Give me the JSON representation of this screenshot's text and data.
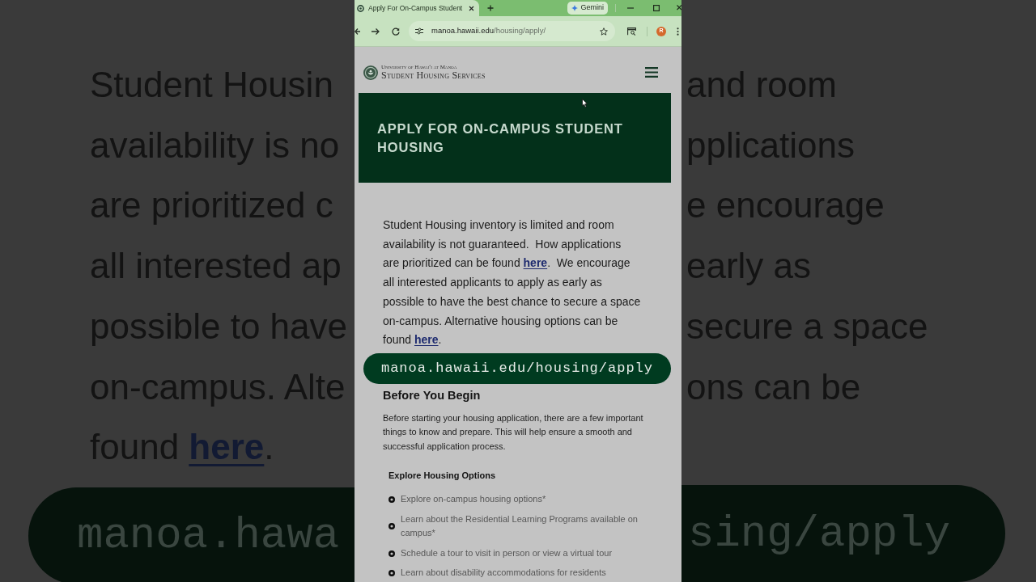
{
  "backdrop": {
    "left_lines": [
      {
        "parts": [
          {
            "kind": "text",
            "text": "Student Housin"
          }
        ]
      },
      {
        "parts": [
          {
            "kind": "text",
            "text": "availability is no"
          }
        ]
      },
      {
        "parts": [
          {
            "kind": "text",
            "text": "are prioritized c"
          }
        ]
      },
      {
        "parts": [
          {
            "kind": "text",
            "text": "all interested ap"
          }
        ]
      },
      {
        "parts": [
          {
            "kind": "text",
            "text": "possible to have"
          }
        ]
      },
      {
        "parts": [
          {
            "kind": "text",
            "text": "on-campus. Alte"
          }
        ]
      },
      {
        "parts": [
          {
            "kind": "text",
            "text": "found "
          },
          {
            "kind": "link",
            "text": "here"
          },
          {
            "kind": "text",
            "text": "."
          }
        ]
      }
    ],
    "right_lines": [
      "and room",
      "pplications",
      "e encourage",
      "early as",
      "secure a space",
      "ons can be"
    ],
    "left_caption": "manoa.hawa",
    "right_caption": "sing/apply"
  },
  "browser": {
    "tab": {
      "title": "Apply For On-Campus Student",
      "selected": true
    },
    "gemini": "Gemini",
    "url": {
      "domain": "manoa.hawaii.edu",
      "path": "/housing/apply/"
    },
    "profile": "R"
  },
  "page": {
    "logo": {
      "tagline": "University of Hawaiʻi at Mānoa",
      "name": "Student Housing Services"
    },
    "hero_title": "APPLY FOR ON-CAMPUS STUDENT HOUSING",
    "intro": [
      {
        "kind": "text",
        "text": "Student Housing inventory is limited and room\navailability is not guaranteed.  How applications\nare prioritized can be found "
      },
      {
        "kind": "link",
        "text": "here"
      },
      {
        "kind": "text",
        "text": ".  We encourage\nall interested applicants to apply as early as\npossible to have the best chance to secure a space\non-campus. Alternative housing options can be\nfound "
      },
      {
        "kind": "link",
        "text": "here"
      },
      {
        "kind": "text",
        "text": "."
      }
    ],
    "url_caption": "manoa.hawaii.edu/housing/apply",
    "section_title": "Before You Begin",
    "section_text": "Before starting your housing application, there are a few important things to know and prepare. This will help ensure a smooth and successful application process.",
    "subsection_title": "Explore Housing Options",
    "checklist": [
      "Explore on-campus housing options*",
      "Learn about the Residential Learning Programs available on campus*",
      "Schedule a tour to visit in person or view a virtual tour",
      "Learn about disability accommodations for residents"
    ]
  }
}
